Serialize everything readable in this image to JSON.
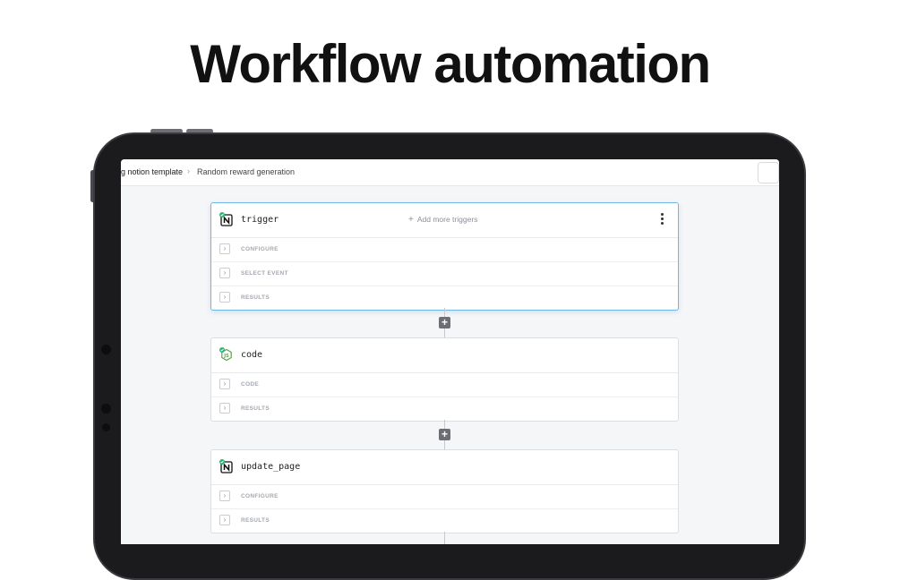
{
  "headline": "Workflow automation",
  "breadcrumb": {
    "parent": "g notion template",
    "separator": "›",
    "current": "Random reward generation"
  },
  "steps": [
    {
      "name": "trigger",
      "app_icon": "notion-icon",
      "status": "success",
      "add_more_label": "Add more triggers",
      "sections": [
        "CONFIGURE",
        "SELECT EVENT",
        "RESULTS"
      ]
    },
    {
      "name": "code",
      "app_icon": "nodejs-icon",
      "status": "success",
      "sections": [
        "CODE",
        "RESULTS"
      ]
    },
    {
      "name": "update_page",
      "app_icon": "notion-icon",
      "status": "success",
      "sections": [
        "CONFIGURE",
        "RESULTS"
      ]
    }
  ],
  "add_step_label": "+",
  "colors": {
    "accent_border": "#6fb7e6",
    "success": "#2bb673",
    "device_bezel": "#1b1b1d"
  }
}
